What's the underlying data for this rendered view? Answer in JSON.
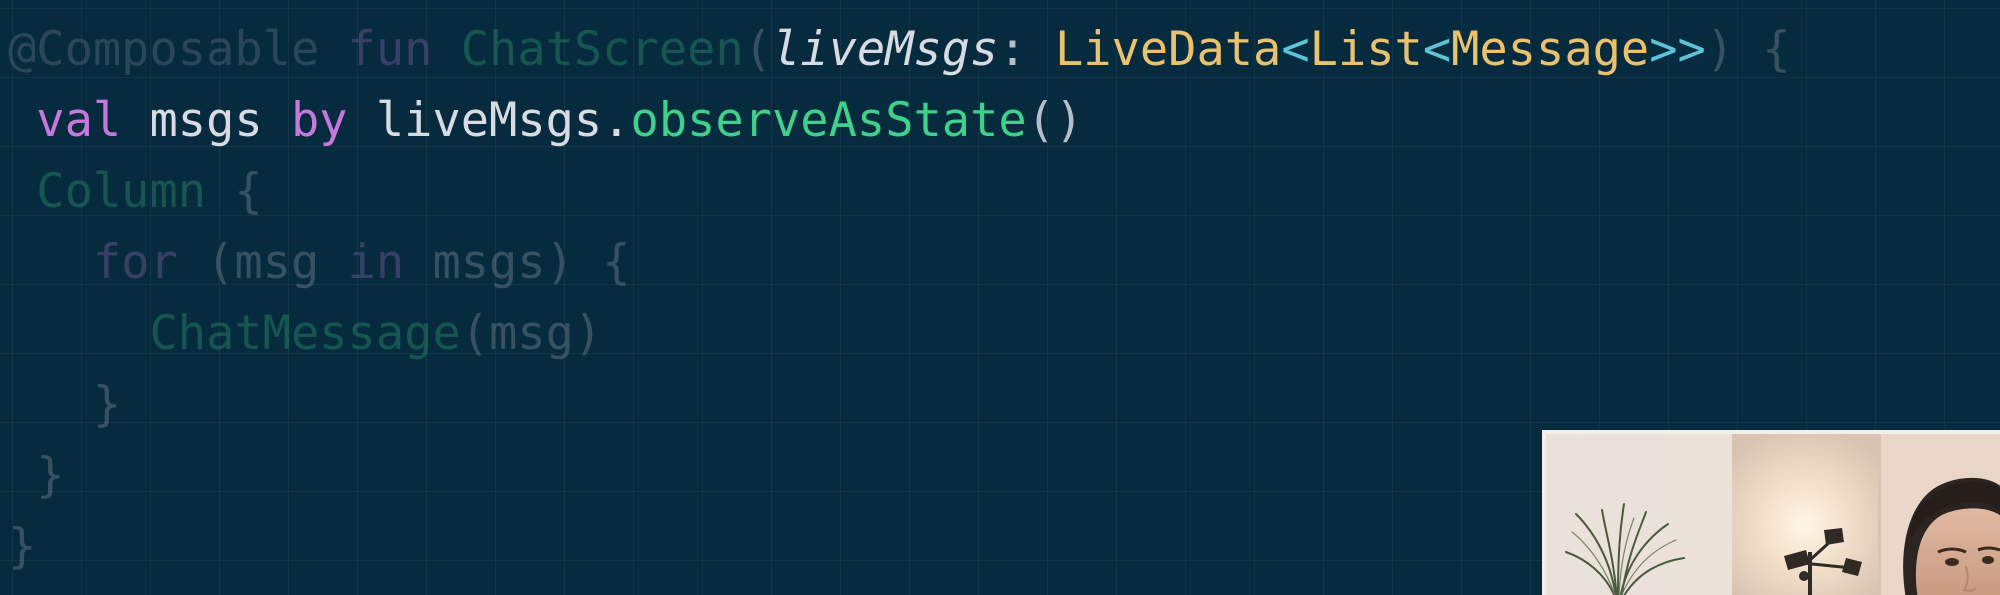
{
  "code_lines": [
    {
      "dim": true,
      "tokens": [
        {
          "text": "@Composable",
          "kind": "annotation"
        },
        {
          "text": " fun ",
          "kind": "keyword"
        },
        {
          "text": "ChatScreen",
          "kind": "function"
        },
        {
          "text": "(",
          "kind": "punct"
        },
        {
          "text": "liveMsgs",
          "kind": "param"
        },
        {
          "text": ": ",
          "kind": "punct"
        },
        {
          "text": "LiveData",
          "kind": "type"
        },
        {
          "text": "<",
          "kind": "generic"
        },
        {
          "text": "List",
          "kind": "type"
        },
        {
          "text": "<",
          "kind": "generic"
        },
        {
          "text": "Message",
          "kind": "type"
        },
        {
          "text": ">>",
          "kind": "generic"
        },
        {
          "text": ") {",
          "kind": "punct"
        }
      ],
      "highlighted_tokens": [
        4,
        5,
        6,
        7,
        8,
        9,
        10,
        11
      ]
    },
    {
      "dim": false,
      "tokens": [
        {
          "text": " val",
          "kind": "keyword"
        },
        {
          "text": " msgs ",
          "kind": "ident"
        },
        {
          "text": "by",
          "kind": "keyword"
        },
        {
          "text": " liveMsgs.",
          "kind": "ident"
        },
        {
          "text": "observeAsState",
          "kind": "function"
        },
        {
          "text": "()",
          "kind": "punct"
        }
      ]
    },
    {
      "dim": true,
      "tokens": [
        {
          "text": " Column",
          "kind": "function"
        },
        {
          "text": " {",
          "kind": "punct"
        }
      ]
    },
    {
      "dim": true,
      "tokens": [
        {
          "text": "   for",
          "kind": "keyword"
        },
        {
          "text": " (msg ",
          "kind": "punct"
        },
        {
          "text": "in",
          "kind": "keyword"
        },
        {
          "text": " msgs) {",
          "kind": "punct"
        }
      ]
    },
    {
      "dim": true,
      "tokens": [
        {
          "text": "     ChatMessage",
          "kind": "function"
        },
        {
          "text": "(msg)",
          "kind": "punct"
        }
      ]
    },
    {
      "dim": true,
      "tokens": [
        {
          "text": "   }",
          "kind": "punct"
        }
      ]
    },
    {
      "dim": true,
      "tokens": [
        {
          "text": " }",
          "kind": "punct"
        }
      ]
    },
    {
      "dim": true,
      "tokens": [
        {
          "text": "}",
          "kind": "punct"
        }
      ]
    }
  ],
  "colors": {
    "background": "#072b3e",
    "grid_line": "#16394b",
    "annotation": "#8a97a3",
    "keyword": "#c678dd",
    "function": "#3fd08a",
    "param": "#d8dbe2",
    "type": "#eac26d",
    "generic": "#5cc4d6",
    "punct": "#b7bec8"
  },
  "webcam_overlay": {
    "content": "presenter-webcam",
    "icon": "presenter-video-icon"
  }
}
